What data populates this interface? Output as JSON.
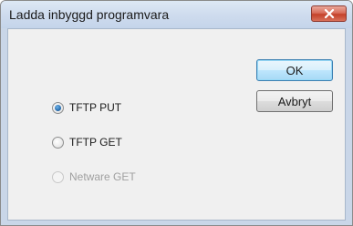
{
  "window": {
    "title": "Ladda inbyggd programvara"
  },
  "buttons": {
    "ok_label": "OK",
    "cancel_label": "Avbryt"
  },
  "options": [
    {
      "label": "TFTP PUT",
      "checked": true,
      "enabled": true
    },
    {
      "label": "TFTP GET",
      "checked": false,
      "enabled": true
    },
    {
      "label": "Netware GET",
      "checked": false,
      "enabled": false
    }
  ],
  "icons": {
    "close": "close-icon"
  },
  "colors": {
    "close_button": "#c4412a",
    "default_button_border": "#3c7fb1"
  }
}
